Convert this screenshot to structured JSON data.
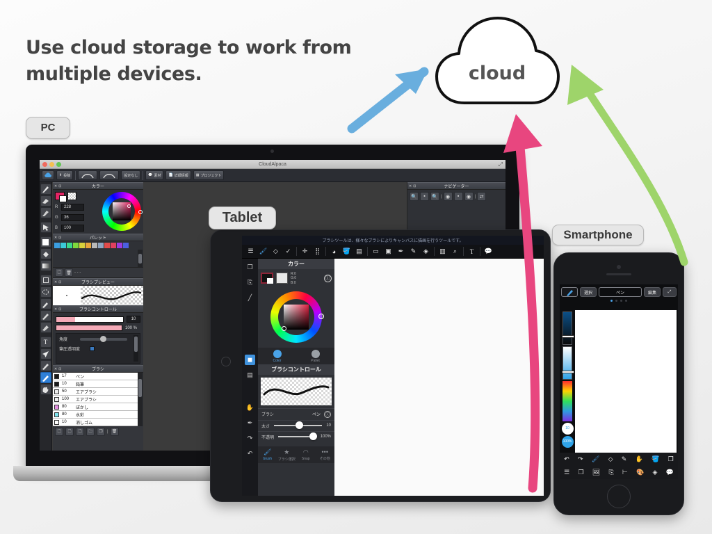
{
  "headline": "Use cloud storage to work from multiple devices.",
  "cloud": {
    "label": "cloud"
  },
  "badges": {
    "pc": "PC",
    "tablet": "Tablet",
    "smartphone": "Smartphone"
  },
  "pc": {
    "window_title": "CloudAlpaca",
    "toolbar": {
      "cloud_icon": "cloud-icon",
      "post_label": "投稿",
      "undo_icon": "undo-curve-icon",
      "redo_icon": "redo-curve-icon",
      "preset_label": "設定なし",
      "material_label": "素材",
      "detail_label": "詳細情報",
      "project_label": "プロジェクト"
    },
    "color_panel": {
      "title": "カラー",
      "r_label": "R",
      "r_value": "228",
      "g_label": "G",
      "g_value": "36",
      "b_label": "B",
      "b_value": "100",
      "fg_color": "#e42464"
    },
    "palette_panel": {
      "title": "パレット",
      "dash": "- - -"
    },
    "brush_preview_panel": {
      "title": "ブラシプレビュー"
    },
    "brush_control_panel": {
      "title": "ブラシコントロール",
      "size_value": "10",
      "opacity_value": "100 %",
      "angle_label": "角度",
      "angle_value": "0",
      "pressure_label": "筆圧透明度"
    },
    "brush_panel": {
      "title": "ブラシ",
      "brushes": [
        {
          "size": "17",
          "name": "ペン",
          "color": "#1a1a1a"
        },
        {
          "size": "10",
          "name": "鉛筆",
          "color": "#1a1a1a"
        },
        {
          "size": "50",
          "name": "エアブラシ",
          "color": "#ededed"
        },
        {
          "size": "100",
          "name": "エアブラシ",
          "color": "#ededed"
        },
        {
          "size": "80",
          "name": "ぼかし",
          "color": "#e38fe0"
        },
        {
          "size": "80",
          "name": "水彩",
          "color": "#7fe3ee"
        },
        {
          "size": "10",
          "name": "消しゴム",
          "color": "#ffffff"
        }
      ]
    },
    "navigator_panel": {
      "title": "ナビゲーター"
    },
    "tools": [
      "pen-icon",
      "eraser-icon",
      "blur-icon",
      "select-arrow-icon",
      "fill-square-icon",
      "bucket-icon",
      "gradient-icon",
      "frame-icon",
      "lasso-icon",
      "eyedropper-icon",
      "magic-wand-icon",
      "stamp-icon",
      "text-icon",
      "move-arrow-icon",
      "pencil-icon",
      "brush-icon",
      "hand-icon"
    ]
  },
  "tablet": {
    "tooltip": "ブラシツールは、様々なブラシによりキャンバスに描画を行うツールです。",
    "color_panel": {
      "title": "カラー",
      "rgb_lines": [
        "R:0",
        "G:0",
        "B:0"
      ],
      "tab_color": "Color",
      "tab_pallet": "Pallet"
    },
    "brush_control_panel": {
      "title": "ブラシコントロール",
      "brush_label": "ブラシ",
      "brush_value": "ペン",
      "size_label": "太さ",
      "size_value": "10",
      "opacity_label": "不透明",
      "opacity_value": "100%"
    },
    "footer_tabs": [
      {
        "label": "brush",
        "icon": "brush-icon",
        "active": true
      },
      {
        "label": "ブラシ選択",
        "icon": "star-icon",
        "active": false
      },
      {
        "label": "Snap",
        "icon": "snap-arc-icon",
        "active": false
      },
      {
        "label": "その他",
        "icon": "ellipsis-icon",
        "active": false
      }
    ],
    "toolbar_icons": [
      "menu-icon",
      "brush-icon",
      "eraser-icon",
      "check-icon",
      "move-icon",
      "select-icon",
      "shape-icon",
      "bucket-icon",
      "gradient-icon",
      "rect-select-icon",
      "rect-lock-icon",
      "eyedropper-icon",
      "edit-icon",
      "wand-icon",
      "film-icon",
      "zoom-icon",
      "text-icon",
      "chat-icon"
    ],
    "side_icons": [
      "layers-copy-icon",
      "layer-rotate-icon",
      "line-icon",
      "fill-square-icon",
      "layer-icon",
      "hand-icon",
      "eyedropper-icon",
      "redo-icon",
      "undo-icon"
    ]
  },
  "phone": {
    "toolbar": {
      "brush_icon": "brush-icon",
      "select_label": "選択",
      "pen_label": "ペン",
      "edit_label": "編集",
      "expand_icon": "expand-icon"
    },
    "opacity_badge": "100%",
    "size_badge": "10",
    "bottom_row_1": [
      "undo-icon",
      "redo-icon",
      "brush-icon",
      "eraser-icon",
      "pencil-icon",
      "hand-icon",
      "bucket-icon",
      "layers-icon"
    ],
    "bottom_row_2": [
      "menu-icon",
      "copy-icon",
      "image-icon",
      "rotate-icon",
      "align-icon",
      "palette-icon",
      "layer-icon",
      "chat-icon"
    ]
  },
  "colors": {
    "arrow_blue": "#69aede",
    "arrow_pink": "#e8467f",
    "arrow_green": "#9ed46a",
    "accent": "#e42464"
  }
}
